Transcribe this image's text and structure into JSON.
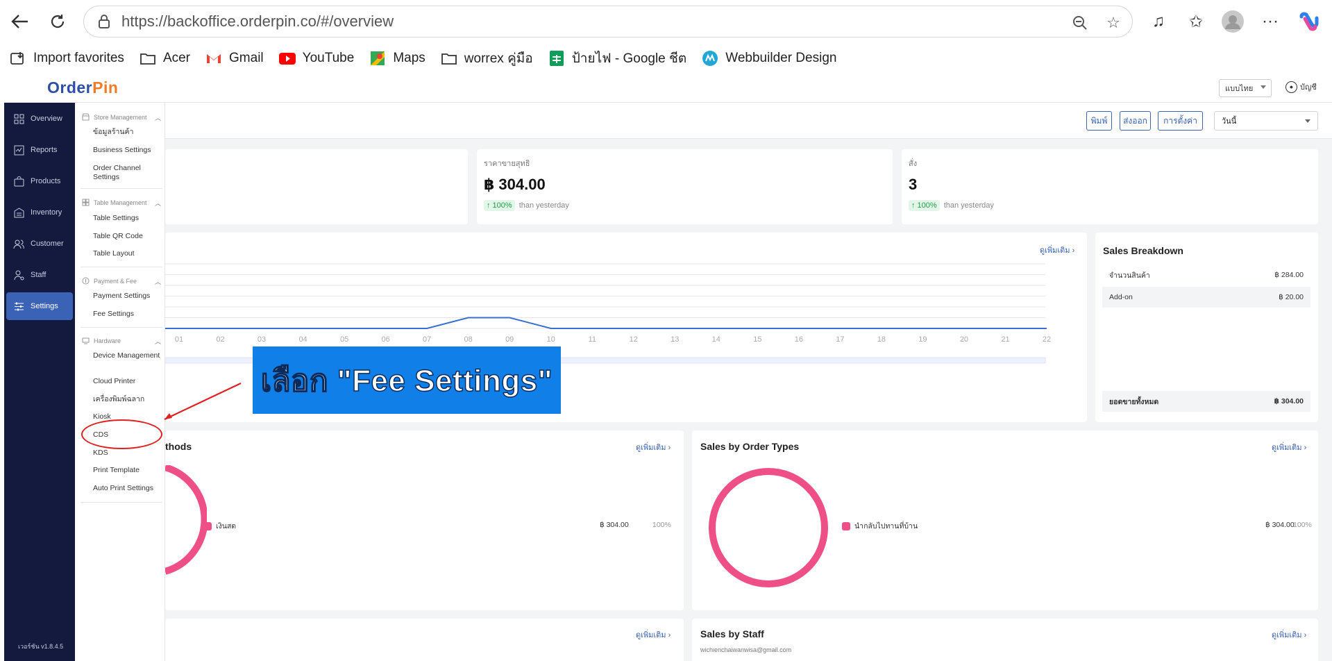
{
  "browser": {
    "url": "https://backoffice.orderpin.co/#/overview",
    "bookmarks": [
      {
        "label": "Import favorites",
        "icon": "import-icon"
      },
      {
        "label": "Acer",
        "icon": "folder-icon"
      },
      {
        "label": "Gmail",
        "icon": "gmail-icon"
      },
      {
        "label": "YouTube",
        "icon": "youtube-icon"
      },
      {
        "label": "Maps",
        "icon": "maps-icon"
      },
      {
        "label": "worrex คู่มือ",
        "icon": "folder-icon"
      },
      {
        "label": "ป้ายไฟ - Google ชีต",
        "icon": "sheets-icon"
      },
      {
        "label": "Webbuilder Design",
        "icon": "webbuilder-icon"
      }
    ]
  },
  "app": {
    "logo": {
      "part1": "Order",
      "part2": "Pin"
    },
    "language": "แบบไทย",
    "account": "บัญชี",
    "version": "เวอร์ชัน v1.8.4.5"
  },
  "sidebar": {
    "items": [
      {
        "label": "Overview",
        "icon": "grid-icon"
      },
      {
        "label": "Reports",
        "icon": "report-icon"
      },
      {
        "label": "Products",
        "icon": "bag-icon"
      },
      {
        "label": "Inventory",
        "icon": "warehouse-icon"
      },
      {
        "label": "Customer",
        "icon": "users-icon"
      },
      {
        "label": "Staff",
        "icon": "staff-icon"
      },
      {
        "label": "Settings",
        "icon": "sliders-icon",
        "active": true
      }
    ]
  },
  "submenu": {
    "groups": [
      {
        "label": "Store Management",
        "icon": "store-icon",
        "items": [
          "ข้อมูลร้านค้า",
          "Business Settings",
          "Order Channel Settings"
        ]
      },
      {
        "label": "Table Management",
        "icon": "table-icon",
        "items": [
          "Table Settings",
          "Table QR Code",
          "Table Layout"
        ]
      },
      {
        "label": "Payment & Fee",
        "icon": "coin-icon",
        "items": [
          "Payment Settings",
          "Fee Settings"
        ]
      },
      {
        "label": "Hardware",
        "icon": "hardware-icon",
        "items": [
          "Device Management",
          "Cloud Printer",
          "เครื่องพิมพ์ฉลาก",
          "Kiosk",
          "CDS",
          "KDS",
          "Print Template",
          "Auto Print Settings"
        ]
      }
    ]
  },
  "toolbar": {
    "print": "พิมพ์",
    "export": "ส่งออก",
    "settings": "การตั้งค่า",
    "period": "วันนี้"
  },
  "stats": [
    {
      "label": "ราคาขายสุทธิ",
      "value": "฿ 304.00",
      "pct": "↑ 100%",
      "compare": "than yesterday"
    },
    {
      "label": "สั่ง",
      "value": "3",
      "pct": "↑ 100%",
      "compare": "than yesterday"
    }
  ],
  "see_more": "ดูเพิ่มเติม ›",
  "chart_data": {
    "type": "line",
    "x": [
      "01",
      "02",
      "03",
      "04",
      "05",
      "06",
      "07",
      "08",
      "09",
      "10",
      "11",
      "12",
      "13",
      "14",
      "15",
      "16",
      "17",
      "18",
      "19",
      "20",
      "21",
      "22"
    ],
    "series": [
      {
        "values": [
          0,
          0,
          0,
          0,
          0,
          0,
          0,
          1,
          1,
          0,
          0,
          0,
          0,
          0,
          0,
          0,
          0,
          0,
          0,
          0,
          0,
          0
        ]
      }
    ],
    "grid": true,
    "color": "#3a6fd0"
  },
  "sales_breakdown": {
    "title": "Sales Breakdown",
    "rows": [
      {
        "label": "จำนวนสินค้า",
        "value": "฿ 284.00"
      },
      {
        "label": "Add-on",
        "value": "฿ 20.00"
      }
    ],
    "total_label": "ยอดขายทั้งหมด",
    "total_value": "฿ 304.00"
  },
  "payment_methods": {
    "title_fragment": "thods",
    "legend": {
      "label": "เงินสด",
      "value": "฿ 304.00",
      "pct": "100%"
    }
  },
  "order_types": {
    "title": "Sales by Order Types",
    "legend": {
      "label": "นำกลับไปทานที่บ้าน",
      "value": "฿ 304.00",
      "pct": "100%"
    }
  },
  "staff": {
    "title": "Sales by Staff",
    "email": "wichienchaiwanwisa@gmail.com"
  },
  "annotation": {
    "text": "เลือก \"Fee Settings\""
  },
  "colors": {
    "accent": "#3a61b3",
    "sidebar": "#141a3d",
    "donut": "#ee4f86",
    "callout": "#1080e8",
    "highlight": "#e0201f"
  }
}
